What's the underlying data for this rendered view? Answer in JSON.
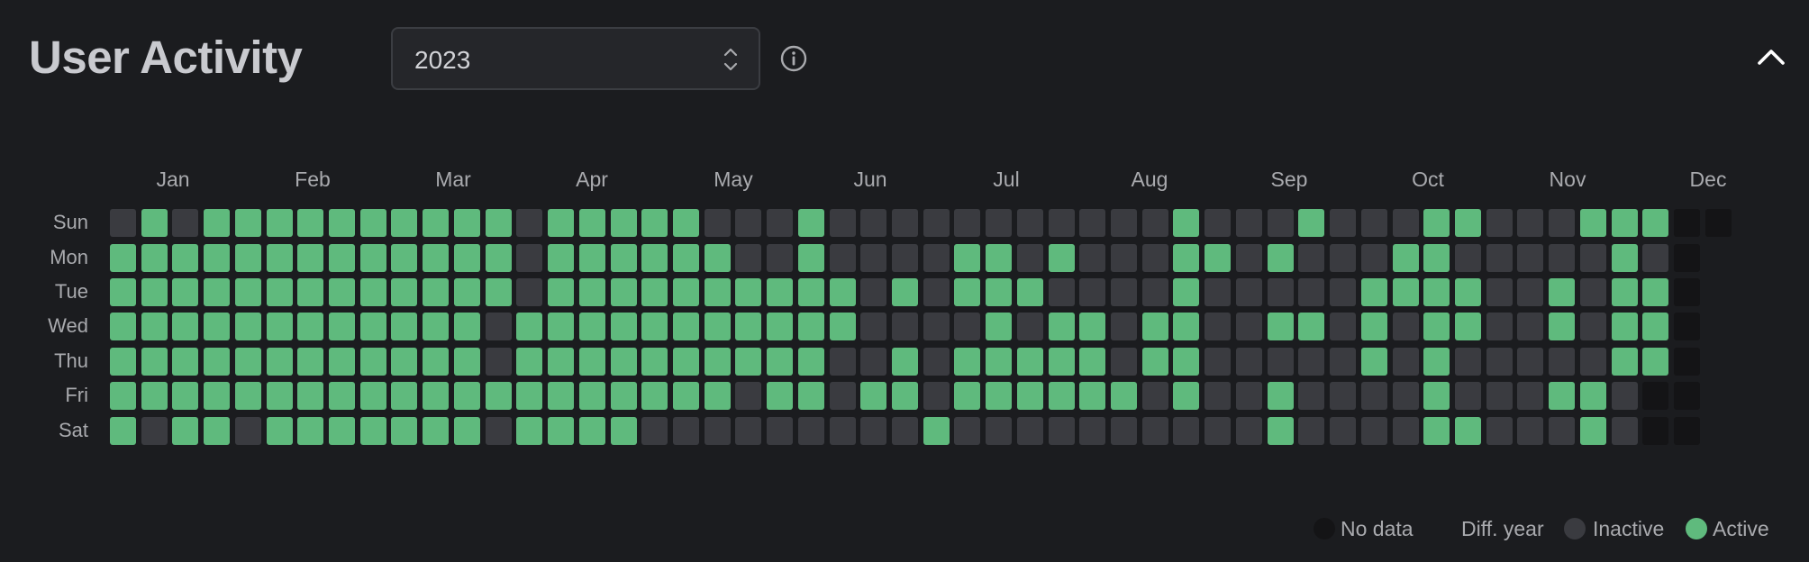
{
  "header": {
    "title": "User Activity",
    "year_select": {
      "value": "2023",
      "stepper_icon": "chevron-up-down-icon"
    },
    "info_icon": "info-icon",
    "collapse_icon": "chevron-up-icon"
  },
  "calendar": {
    "months": [
      "Jan",
      "Feb",
      "Mar",
      "Apr",
      "May",
      "Jun",
      "Jul",
      "Aug",
      "Sep",
      "Oct",
      "Nov",
      "Dec"
    ],
    "days": [
      "Sun",
      "Mon",
      "Tue",
      "Wed",
      "Thu",
      "Fri",
      "Sat"
    ],
    "rows": [
      "IAIAAAAAAAAAAIAAAAAIIIAIIIIIIIIIIIAIIIAIIIAAIIIAAANN",
      "AAAAAAAAAAAAAIAAAAAAIIAIIIIAAIAIIIAAIAIIIAAIIIIIAIN",
      "AAAAAAAAAAAAAIAAAAAAAAAAIAIAAAIIIIAIIIIIAAAAIIAIAAN",
      "AAAAAAAAAAAAIAAAAAAAAAAAIIIIAIAAIAAIIAAIAIAAIIAIAAN",
      "AAAAAAAAAAAAIAAAAAAAAAAIIAIAAAAAIAAIIIIIAIAIIIIIAAN",
      "AAAAAAAAAAAAAAAAAAAAIAAIAAIAAAAAAIAIIAIIIIAIIIAAINN",
      "AIAAIAAAAAAAIAAAAIIIIIIIIIAIIIIIIIIIIAIIIIAAIIIAINN"
    ]
  },
  "legend": {
    "items": [
      {
        "label": "No data",
        "color": "#141416"
      },
      {
        "label": "Diff. year",
        "color": ""
      },
      {
        "label": "Inactive",
        "color": "#3a3b40"
      },
      {
        "label": "Active",
        "color": "#5fba7d"
      }
    ]
  },
  "colors": {
    "active": "#5fba7d",
    "inactive": "#3a3b40",
    "no_data": "#141416",
    "background": "#1b1c1f"
  }
}
